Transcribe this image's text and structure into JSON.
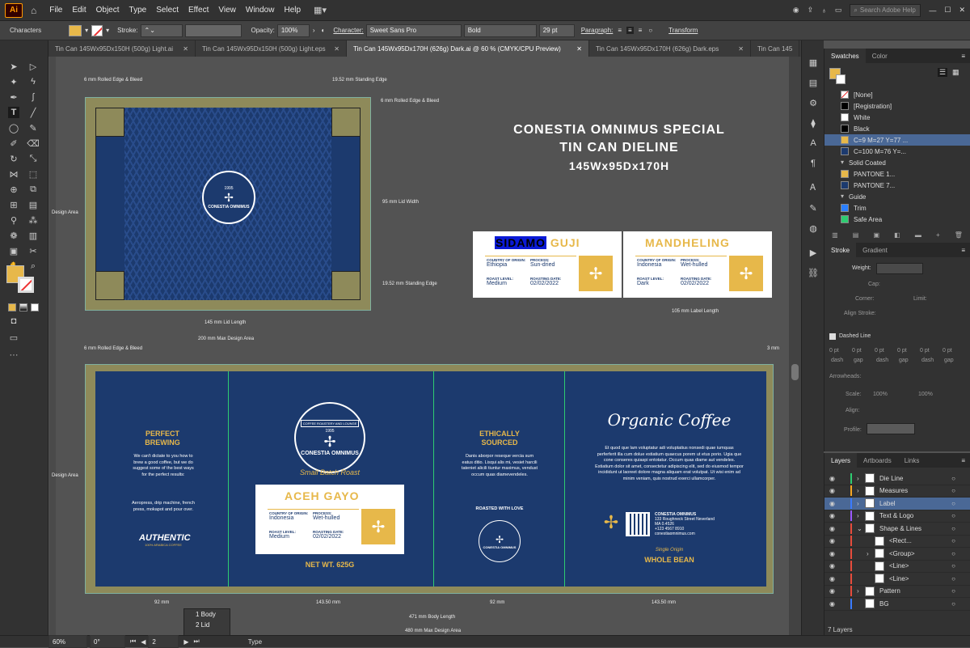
{
  "app": {
    "logo": "Ai"
  },
  "menu": [
    "File",
    "Edit",
    "Object",
    "Type",
    "Select",
    "Effect",
    "View",
    "Window",
    "Help"
  ],
  "search": {
    "placeholder": "Search Adobe Help"
  },
  "control": {
    "panel_label": "Characters",
    "stroke_label": "Stroke:",
    "opacity_label": "Opacity:",
    "opacity_value": "100%",
    "character_label": "Character:",
    "font_family": "Sweet Sans Pro",
    "font_style": "Bold",
    "font_size": "29 pt",
    "paragraph_label": "Paragraph:",
    "transform_label": "Transform"
  },
  "tabs": [
    "Tin Can 145Wx95Dx150H (500g) Light.ai",
    "Tin Can 145Wx95Dx150H (500g) Light.eps",
    "Tin Can 145Wx95Dx170H (626g) Dark.ai @ 60 % (CMYK/CPU Preview)",
    "Tin Can 145Wx95Dx170H (626g) Dark.eps",
    "Tin Can 145"
  ],
  "artboard": {
    "title_line1": "CONESTIA OMNIMUS SPECIAL",
    "title_line2": "TIN CAN DIELINE",
    "title_line3": "145Wx95Dx170H",
    "dims": {
      "rolled_bleed": "6 mm Rolled Edge & Bleed",
      "standing_top": "19.52 mm Standing Edge",
      "rolled_bleed_right": "6 mm Rolled Edge & Bleed",
      "lid_width": "95 mm Lid Width",
      "standing_edge": "19.52 mm Standing Edge",
      "lid_length": "145 mm Lid Length",
      "max_design": "200 mm Max Design Area",
      "label_length": "105 mm Label Length",
      "rolled_bleed_body": "6 mm Rolled Edge & Bleed",
      "mm3": "3 mm",
      "body_length": "471 mm Body Length",
      "max_design_body": "480 mm Max Design Area",
      "seg1": "92 mm",
      "seg2": "143.50 mm",
      "seg3": "92 mm",
      "seg4": "143.50 mm",
      "design_area": "Design Area"
    },
    "brand": "CONESTIA OMNIMUS",
    "brand_top": "COFFEE ROASTERY AND LOUNGE",
    "brand_year": "1995",
    "label1": {
      "name_a": "SIDAMO",
      "name_b": "GUJI",
      "origin_label": "COUNTRY OF ORIGIN:",
      "origin": "Ethiopia",
      "process_label": "PROCESS:",
      "process": "Sun-dried",
      "roast_label": "ROAST LEVEL:",
      "roast": "Medium",
      "date_label": "ROASTING DATE:",
      "date": "02/02/2022"
    },
    "label2": {
      "name": "MANDHELING",
      "origin_label": "COUNTRY OF ORIGIN:",
      "origin": "Indonesia",
      "process_label": "PROCESS:",
      "process": "Wet-hulled",
      "roast_label": "ROAST LEVEL:",
      "roast": "Dark",
      "date_label": "ROASTING DATE:",
      "date": "02/02/2022"
    },
    "label3": {
      "name": "ACEH GAYO",
      "origin_label": "COUNTRY OF ORIGIN:",
      "origin": "Indonesia",
      "process_label": "PROCESS:",
      "process": "Wet-hulled",
      "roast_label": "ROAST LEVEL:",
      "roast": "Medium",
      "date_label": "ROASTING DATE:",
      "date": "02/02/2022"
    },
    "perfect_title": "PERFECT BREWING",
    "perfect_text": "We can't dictate to you how to brew a good coffee, but we do suggest some of the best ways for the perfect results:",
    "perfect_text2": "Aeropress, drip machine, french press, mokapot and pour over.",
    "authentic": "AUTHENTIC",
    "authentic_sub": "100% ARABICA COFFEE",
    "small_batch": "Small Batch Roast",
    "net_wt": "NET WT. 625G",
    "ethic_title": "ETHICALLY SOURCED",
    "ethic_text": "Danis aborpor reseque vercia sum eatus ditio. Lisqui alis mi, vesiet harcili tateniet alicili tiuntur maximus, vendust occum quas diamevendeles.",
    "roasted": "ROASTED WITH LOVE",
    "organic": "Organic Coffee",
    "organic_text": "Et quod que lam voluptatur adi voluptatius nonsedi quae iumquas perferferit illa cum dolue estiatium quaecus porem ut etus porio. Ugia que cone conseres quiaspi entotatur. Occum quas diame aut vendeles. Estiatium dolor sit amet, consectetur adipiscing elit, sed do eiusmod tempor incididunt ut laoreet dolore magna aliquam erat volutpat. Ut wisi enim ad minim veniam, quis nostrud exerci ullamcorper.",
    "address": [
      "CONESTIA OMNIMUS",
      "133 Roughneck Street Neverland",
      "MA 0.4526",
      "+123 4567 8910",
      "conestiaomnimus.com"
    ],
    "single_origin": "Single Origin",
    "whole_bean": "WHOLE BEAN"
  },
  "swatches": {
    "tabs": [
      "Swatches",
      "Color"
    ],
    "items": [
      {
        "name": "[None]"
      },
      {
        "name": "[Registration]",
        "color": "#000000"
      },
      {
        "name": "White",
        "color": "#ffffff"
      },
      {
        "name": "Black",
        "color": "#000000"
      },
      {
        "name": "C=9 M=27 Y=77 ...",
        "color": "#e7b84a"
      },
      {
        "name": "C=100 M=76 Y=...",
        "color": "#1c3a6e"
      },
      {
        "name": "Solid Coated"
      },
      {
        "name": "PANTONE 1...",
        "color": "#e7b84a"
      },
      {
        "name": "PANTONE 7...",
        "color": "#1c3a6e"
      },
      {
        "name": "Guide"
      },
      {
        "name": "Trim",
        "color": "#2a7fff"
      },
      {
        "name": "Safe Area",
        "color": "#2ecc71"
      }
    ]
  },
  "stroke": {
    "tabs": [
      "Stroke",
      "Gradient"
    ],
    "weight": "Weight:",
    "cap": "Cap:",
    "corner": "Corner:",
    "limit": "Limit:",
    "align": "Align Stroke:",
    "dashed": "Dashed Line",
    "dash_vals": [
      "0 pt",
      "0 pt",
      "0 pt",
      "0 pt",
      "0 pt",
      "0 pt"
    ],
    "dash_labels": [
      "dash",
      "gap",
      "dash",
      "gap",
      "dash",
      "gap"
    ],
    "arrowheads": "Arrowheads:",
    "scale": "Scale:",
    "scale_vals": [
      "100%",
      "100%"
    ],
    "align2": "Align:",
    "profile": "Profile:"
  },
  "layers": {
    "tabs": [
      "Layers",
      "Artboards",
      "Links"
    ],
    "items": [
      {
        "name": "Die Line",
        "color": "#2ecc71"
      },
      {
        "name": "Measures",
        "color": "#f5a623"
      },
      {
        "name": "Label",
        "color": "#3a7bff"
      },
      {
        "name": "Text & Logo",
        "color": "#9b59ff"
      },
      {
        "name": "Shape & Lines",
        "color": "#e74c3c"
      },
      {
        "name": "<Rect...",
        "color": "#e74c3c"
      },
      {
        "name": "<Group>",
        "color": "#e74c3c"
      },
      {
        "name": "<Line>",
        "color": "#e74c3c"
      },
      {
        "name": "<Line>",
        "color": "#e74c3c"
      },
      {
        "name": "Pattern",
        "color": "#e74c3c"
      },
      {
        "name": "BG",
        "color": "#3a7bff"
      }
    ],
    "count": "7 Layers"
  },
  "popup": [
    "1 Body",
    "2 Lid"
  ],
  "status": {
    "zoom": "60%",
    "rotate": "0°",
    "artboard": "2",
    "tool": "Type"
  }
}
